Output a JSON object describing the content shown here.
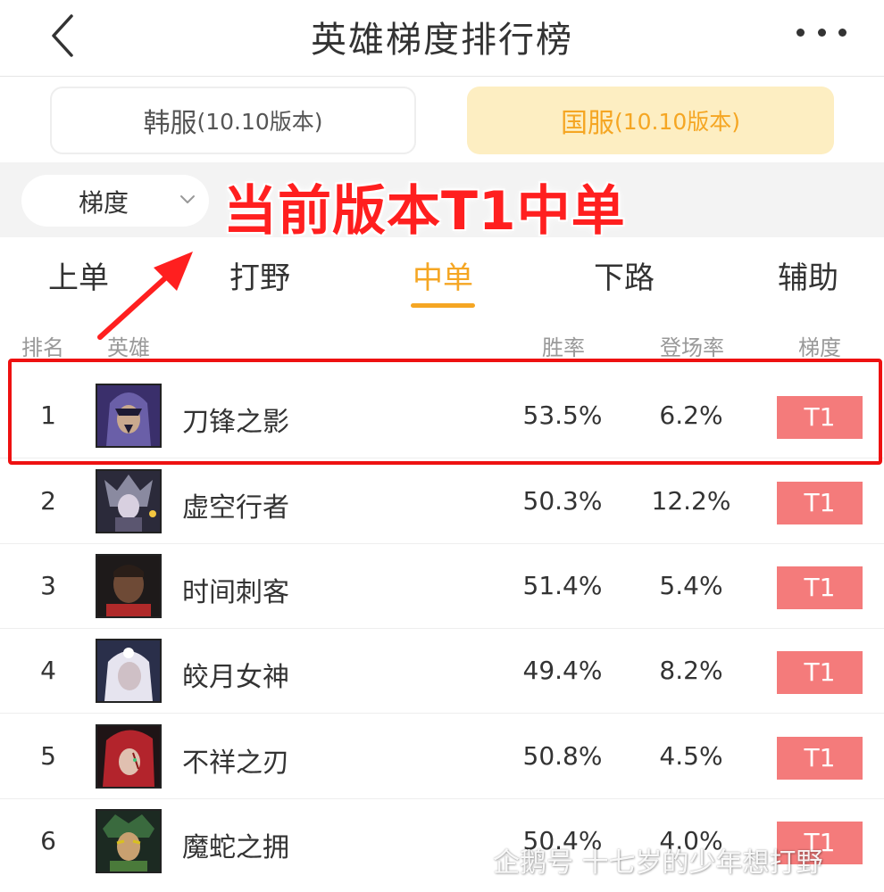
{
  "header": {
    "title": "英雄梯度排行榜"
  },
  "server_tabs": [
    {
      "name": "韩服",
      "version": "(10.10版本)",
      "active": false
    },
    {
      "name": "国服",
      "version": "(10.10版本)",
      "active": true
    }
  ],
  "filter": {
    "selected": "梯度"
  },
  "annotation": "当前版本T1中单",
  "position_tabs": [
    {
      "label": "上单",
      "active": false
    },
    {
      "label": "打野",
      "active": false
    },
    {
      "label": "中单",
      "active": true
    },
    {
      "label": "下路",
      "active": false
    },
    {
      "label": "辅助",
      "active": false
    }
  ],
  "table": {
    "columns": [
      "排名",
      "英雄",
      "胜率",
      "登场率",
      "梯度"
    ],
    "rows": [
      {
        "rank": "1",
        "hero": "刀锋之影",
        "win_rate": "53.5%",
        "pick_rate": "6.2%",
        "tier": "T1",
        "icon": "hero-portrait-icon"
      },
      {
        "rank": "2",
        "hero": "虚空行者",
        "win_rate": "50.3%",
        "pick_rate": "12.2%",
        "tier": "T1",
        "icon": "hero-portrait-icon"
      },
      {
        "rank": "3",
        "hero": "时间刺客",
        "win_rate": "51.4%",
        "pick_rate": "5.4%",
        "tier": "T1",
        "icon": "hero-portrait-icon"
      },
      {
        "rank": "4",
        "hero": "皎月女神",
        "win_rate": "49.4%",
        "pick_rate": "8.2%",
        "tier": "T1",
        "icon": "hero-portrait-icon"
      },
      {
        "rank": "5",
        "hero": "不祥之刃",
        "win_rate": "50.8%",
        "pick_rate": "4.5%",
        "tier": "T1",
        "icon": "hero-portrait-icon"
      },
      {
        "rank": "6",
        "hero": "魔蛇之拥",
        "win_rate": "50.4%",
        "pick_rate": "4.0%",
        "tier": "T1",
        "icon": "hero-portrait-icon"
      }
    ]
  },
  "watermark": "企鹅号 十七岁的少年想打野",
  "colors": {
    "accent": "#f5a623",
    "tier_badge": "#f47b7b",
    "highlight": "#ee1111",
    "selected_tab_bg": "#fdeec2"
  }
}
